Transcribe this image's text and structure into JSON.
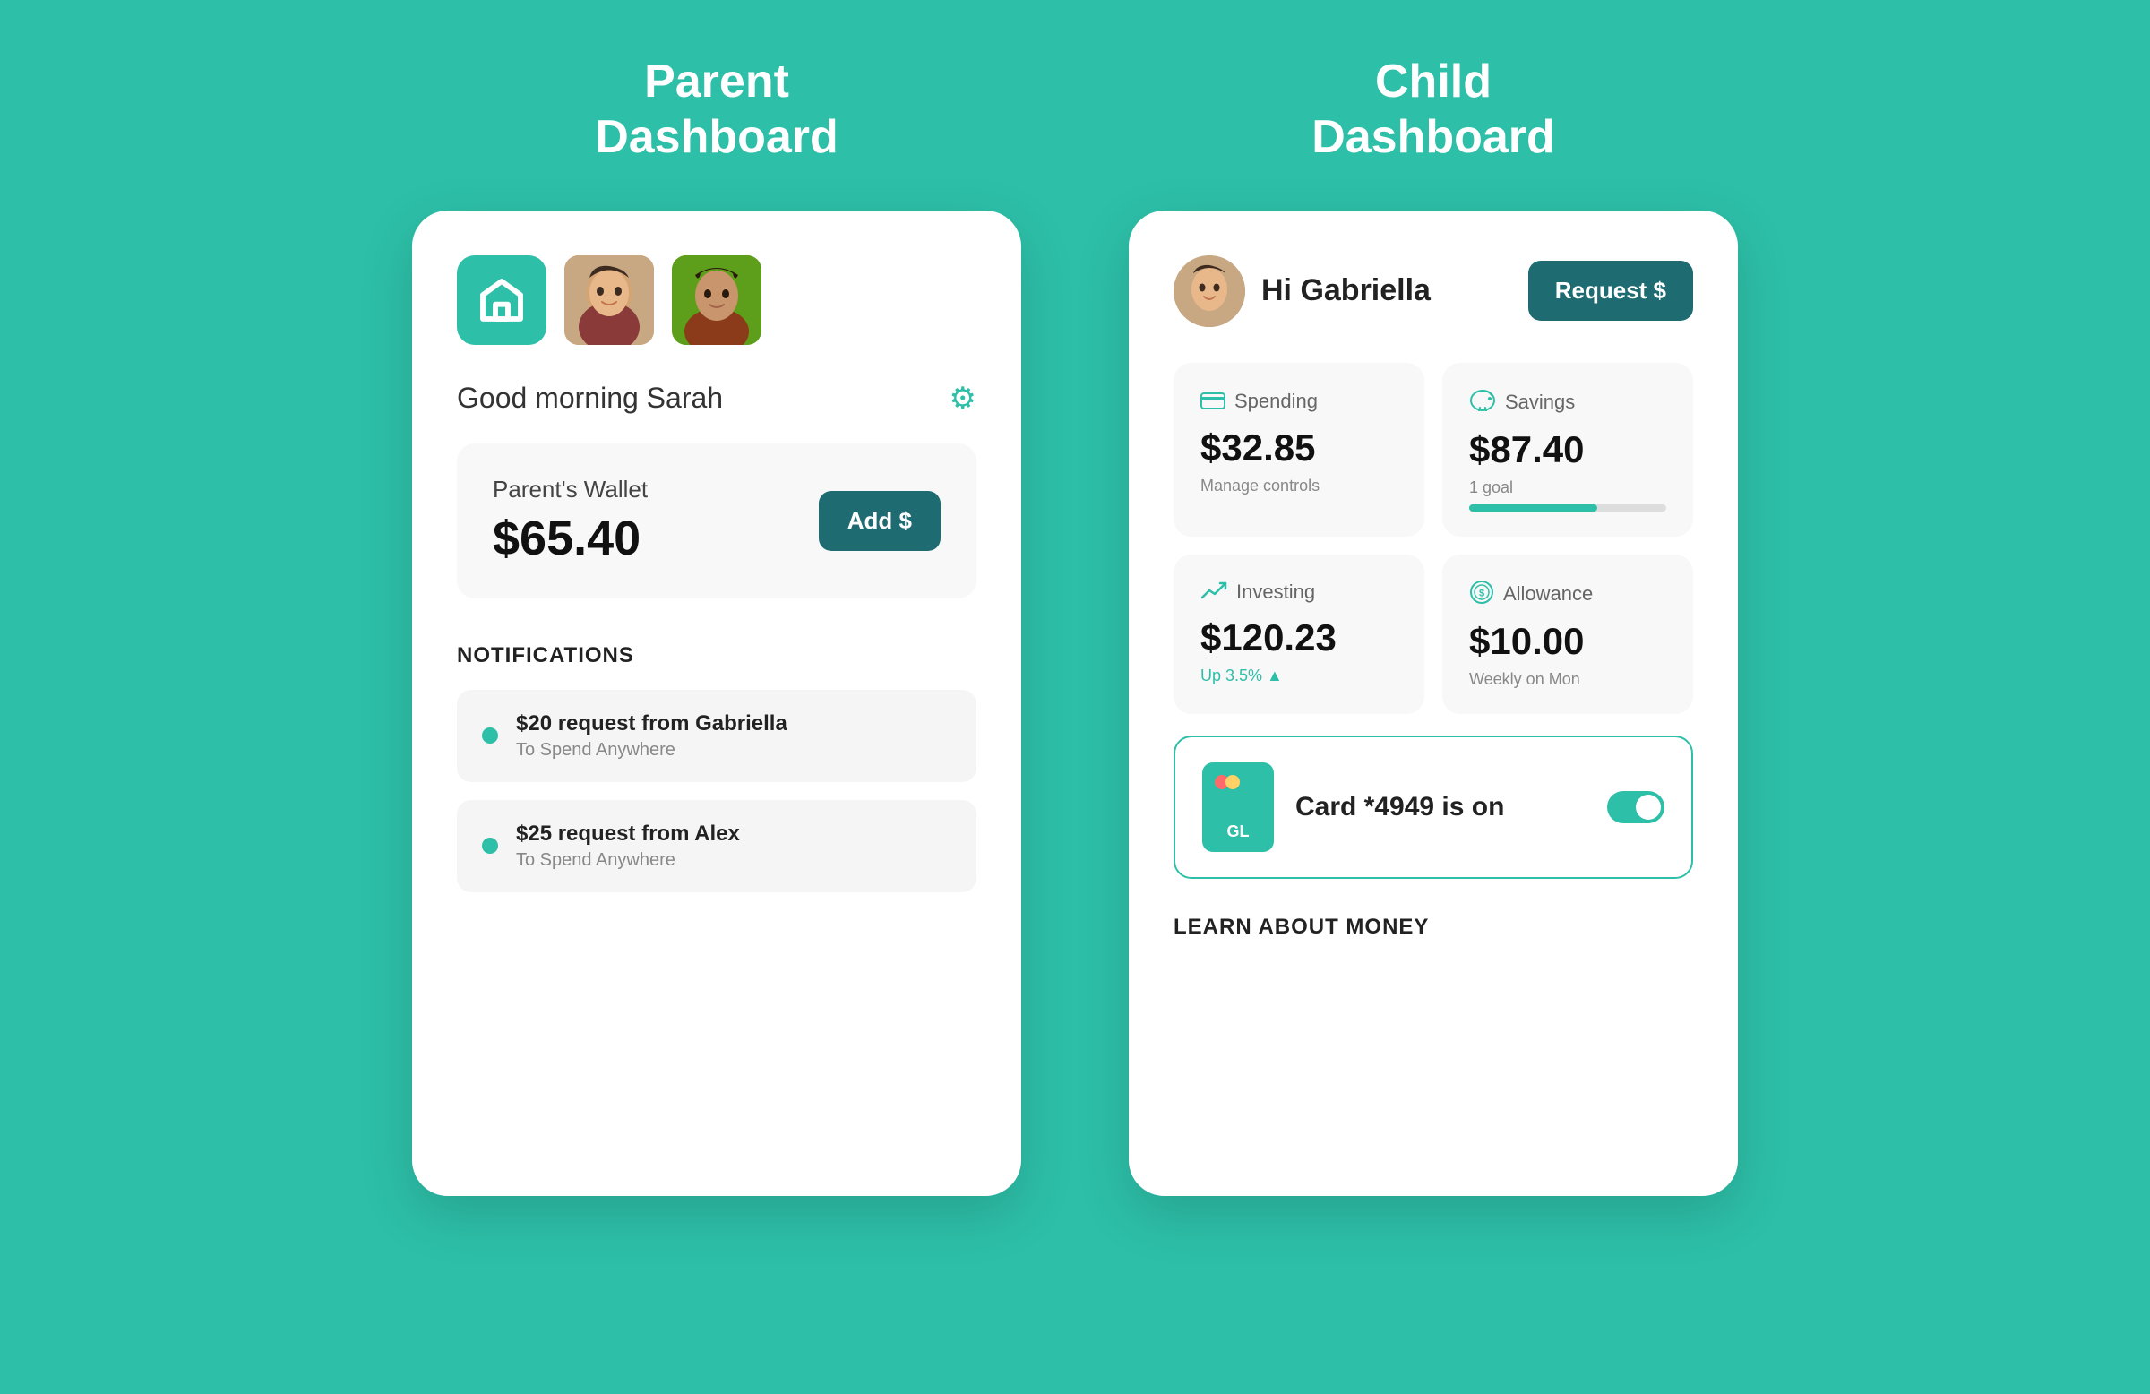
{
  "parent": {
    "section_title": "Parent\nDashboard",
    "greeting": "Good morning Sarah",
    "wallet": {
      "label": "Parent's Wallet",
      "amount": "$65.40",
      "add_button": "Add $"
    },
    "notifications_title": "NOTIFICATIONS",
    "notifications": [
      {
        "main": "$20 request from Gabriella",
        "sub": "To Spend Anywhere"
      },
      {
        "main": "$25 request from Alex",
        "sub": "To Spend Anywhere"
      }
    ]
  },
  "child": {
    "section_title": "Child\nDashboard",
    "greeting": "Hi Gabriella",
    "request_button": "Request $",
    "stats": [
      {
        "icon": "💳",
        "title": "Spending",
        "amount": "$32.85",
        "sub": "Manage controls",
        "has_progress": false
      },
      {
        "icon": "🐷",
        "title": "Savings",
        "amount": "$87.40",
        "sub": "1 goal",
        "has_progress": true
      },
      {
        "icon": "📈",
        "title": "Investing",
        "amount": "$120.23",
        "sub": "Up 3.5% ▲",
        "has_progress": false
      },
      {
        "icon": "💰",
        "title": "Allowance",
        "amount": "$10.00",
        "sub": "Weekly on Mon",
        "has_progress": false
      }
    ],
    "card_text": "Card *4949 is on",
    "card_label": "GL",
    "learn_title": "LEARN ABOUT MONEY"
  }
}
